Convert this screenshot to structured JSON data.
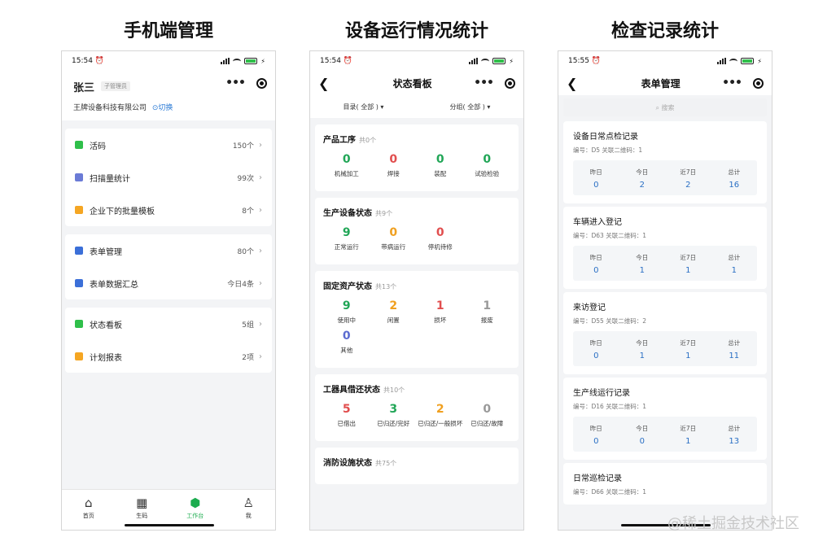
{
  "titles": {
    "panel1": "手机端管理",
    "panel2": "设备运行情况统计",
    "panel3": "检查记录统计"
  },
  "panel1": {
    "time": "15:54 ⏰",
    "user_name": "张三",
    "role": "子管理员",
    "company": "王牌设备科技有限公司",
    "switch_label": "⊙切换",
    "groups": [
      [
        {
          "label": "活码",
          "value": "150个",
          "icon": "qr-grid-icon",
          "color": "#2fbf4a"
        },
        {
          "label": "扫描量统计",
          "value": "99次",
          "icon": "chart-icon",
          "color": "#6b7bd6"
        },
        {
          "label": "企业下的批量模板",
          "value": "8个",
          "icon": "template-icon",
          "color": "#f5a623"
        }
      ],
      [
        {
          "label": "表单管理",
          "value": "80个",
          "icon": "form-icon",
          "color": "#3b6fd8"
        },
        {
          "label": "表单数据汇总",
          "value": "今日4条",
          "icon": "data-search-icon",
          "color": "#3b6fd8"
        }
      ],
      [
        {
          "label": "状态看板",
          "value": "5组",
          "icon": "status-board-icon",
          "color": "#2fbf4a"
        },
        {
          "label": "计划报表",
          "value": "2项",
          "icon": "plan-icon",
          "color": "#f5a623"
        }
      ]
    ],
    "tabs": [
      {
        "label": "首页",
        "icon": "⌂"
      },
      {
        "label": "生码",
        "icon": "▦"
      },
      {
        "label": "工作台",
        "icon": "⬢"
      },
      {
        "label": "我",
        "icon": "♙"
      }
    ]
  },
  "panel2": {
    "time": "15:54 ⏰",
    "nav_title": "状态看板",
    "filter_dir": "目录( 全部 ) ▾",
    "filter_group": "分组( 全部 ) ▾",
    "cards": [
      {
        "title": "产品工序",
        "count": "共0个",
        "stats": [
          {
            "num": "0",
            "label": "机械加工",
            "color": "#21a657"
          },
          {
            "num": "0",
            "label": "焊接",
            "color": "#e14e4e"
          },
          {
            "num": "0",
            "label": "装配",
            "color": "#21a657"
          },
          {
            "num": "0",
            "label": "试验检验",
            "color": "#21a657"
          }
        ]
      },
      {
        "title": "生产设备状态",
        "count": "共9个",
        "stats": [
          {
            "num": "9",
            "label": "正常运行",
            "color": "#21a657"
          },
          {
            "num": "0",
            "label": "带病运行",
            "color": "#f0a020"
          },
          {
            "num": "0",
            "label": "停机待修",
            "color": "#e14e4e"
          }
        ]
      },
      {
        "title": "固定资产状态",
        "count": "共13个",
        "stats": [
          {
            "num": "9",
            "label": "使用中",
            "color": "#21a657"
          },
          {
            "num": "2",
            "label": "闲置",
            "color": "#f0a020"
          },
          {
            "num": "1",
            "label": "损坏",
            "color": "#e14e4e"
          },
          {
            "num": "1",
            "label": "报废",
            "color": "#999999"
          },
          {
            "num": "0",
            "label": "其他",
            "color": "#5b6bd0"
          }
        ]
      },
      {
        "title": "工器具借还状态",
        "count": "共10个",
        "stats": [
          {
            "num": "5",
            "label": "已借出",
            "color": "#e14e4e"
          },
          {
            "num": "3",
            "label": "已归还/完好",
            "color": "#21a657"
          },
          {
            "num": "2",
            "label": "已归还/一般损坏",
            "color": "#f0a020"
          },
          {
            "num": "0",
            "label": "已归还/故障",
            "color": "#999999"
          }
        ]
      },
      {
        "title": "消防设施状态",
        "count": "共75个",
        "stats": []
      }
    ]
  },
  "panel3": {
    "time": "15:55 ⏰",
    "nav_title": "表单管理",
    "search_placeholder": "⌕ 搜索",
    "col_labels": [
      "昨日",
      "今日",
      "近7日",
      "总计"
    ],
    "records": [
      {
        "title": "设备日常点检记录",
        "sub": "编号：D5 关联二维码：1",
        "values": [
          "0",
          "2",
          "2",
          "16"
        ]
      },
      {
        "title": "车辆进入登记",
        "sub": "编号：D63 关联二维码：1",
        "values": [
          "0",
          "1",
          "1",
          "1"
        ]
      },
      {
        "title": "来访登记",
        "sub": "编号：D55 关联二维码：2",
        "values": [
          "0",
          "1",
          "1",
          "11"
        ]
      },
      {
        "title": "生产线运行记录",
        "sub": "编号：D16 关联二维码：1",
        "values": [
          "0",
          "0",
          "1",
          "13"
        ]
      },
      {
        "title": "日常巡检记录",
        "sub": "编号：D66 关联二维码：1",
        "values": []
      }
    ]
  },
  "watermark": "@稀土掘金技术社区"
}
